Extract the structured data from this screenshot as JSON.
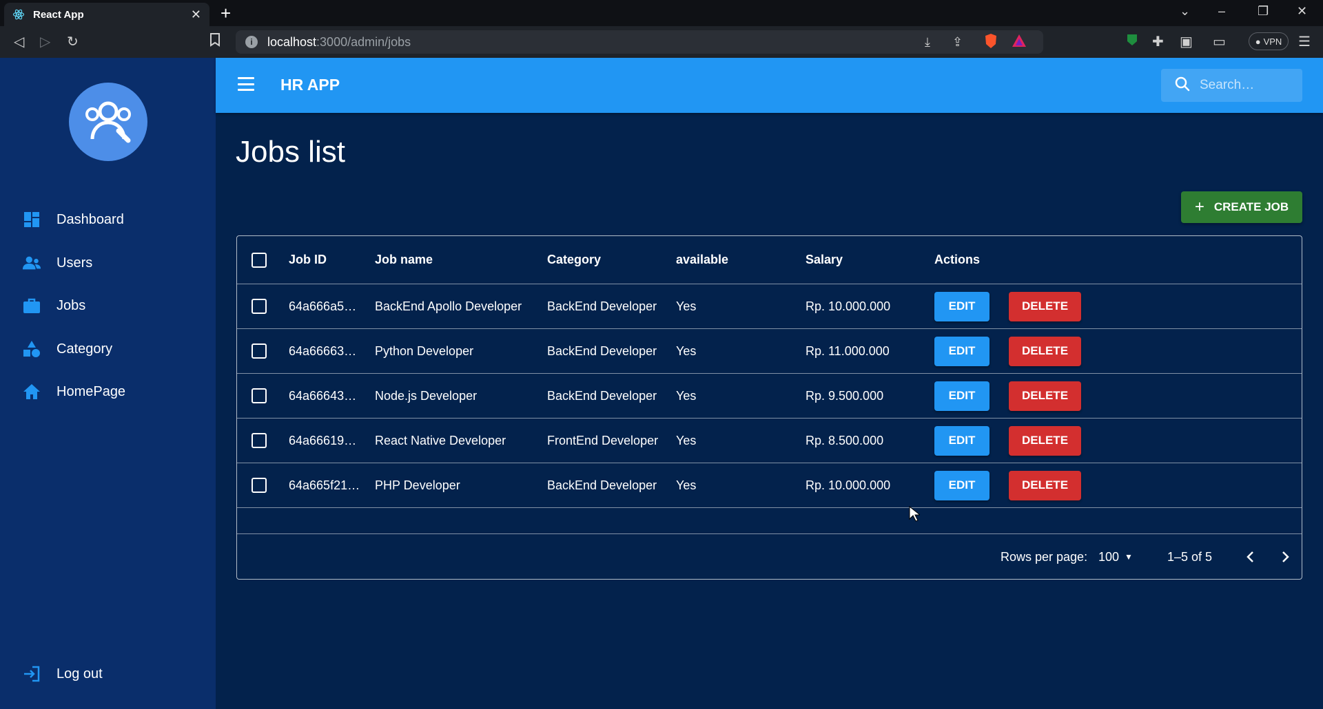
{
  "browser": {
    "tab_title": "React App",
    "url_host": "localhost",
    "url_path": ":3000/admin/jobs",
    "vpn_label": "VPN"
  },
  "sidebar": {
    "items": [
      {
        "label": "Dashboard",
        "icon": "dashboard-icon"
      },
      {
        "label": "Users",
        "icon": "users-icon"
      },
      {
        "label": "Jobs",
        "icon": "briefcase-icon"
      },
      {
        "label": "Category",
        "icon": "category-icon"
      },
      {
        "label": "HomePage",
        "icon": "home-icon"
      }
    ],
    "logout_label": "Log out"
  },
  "header": {
    "title": "HR APP",
    "search_placeholder": "Search…"
  },
  "main": {
    "page_title": "Jobs list",
    "create_label": "CREATE JOB"
  },
  "table": {
    "columns": [
      "Job ID",
      "Job name",
      "Category",
      "available",
      "Salary",
      "Actions"
    ],
    "rows": [
      {
        "id": "64a666a5…",
        "name": "BackEnd Apollo Developer",
        "category": "BackEnd Developer",
        "available": "Yes",
        "salary": "Rp. 10.000.000"
      },
      {
        "id": "64a66663…",
        "name": "Python Developer",
        "category": "BackEnd Developer",
        "available": "Yes",
        "salary": "Rp. 11.000.000"
      },
      {
        "id": "64a66643…",
        "name": "Node.js Developer",
        "category": "BackEnd Developer",
        "available": "Yes",
        "salary": "Rp. 9.500.000"
      },
      {
        "id": "64a66619…",
        "name": "React Native Developer",
        "category": "FrontEnd Developer",
        "available": "Yes",
        "salary": "Rp. 8.500.000"
      },
      {
        "id": "64a665f21…",
        "name": "PHP Developer",
        "category": "BackEnd Developer",
        "available": "Yes",
        "salary": "Rp. 10.000.000"
      }
    ],
    "edit_label": "EDIT",
    "delete_label": "DELETE",
    "rows_per_page_label": "Rows per page:",
    "rows_per_page_value": "100",
    "range_label": "1–5 of 5"
  },
  "colors": {
    "background": "#03224c",
    "sidebar": "#0a2e6b",
    "appbar": "#2196f3",
    "create": "#2e7d32",
    "edit": "#2196f3",
    "delete": "#d32f2f"
  }
}
